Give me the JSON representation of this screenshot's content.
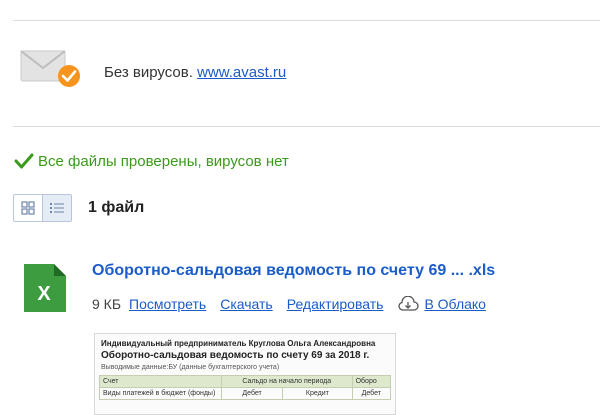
{
  "avast": {
    "text": "Без вирусов.",
    "link": "www.avast.ru"
  },
  "scan": {
    "status": "Все файлы проверены, вирусов нет"
  },
  "view": {
    "grid_icon": "grid-view-icon",
    "list_icon": "list-view-icon",
    "file_count": "1 файл"
  },
  "file": {
    "icon": "xls-icon",
    "badge": "X",
    "name": "Оборотно-сальдовая ведомость по счету 69 ... .xls",
    "size": "9 КБ",
    "actions": {
      "view": "Посмотреть",
      "download": "Скачать",
      "edit": "Редактировать",
      "cloud": "В Облако"
    }
  },
  "preview": {
    "line1": "Индивидуальный предприниматель Круглова Ольга Александровна",
    "line2": "Оборотно-сальдовая ведомость по счету 69 за 2018 г.",
    "line3": "Выводимые данные:БУ (данные бухгалтерского учета)",
    "row1": [
      "Счет",
      "Сальдо на начало периода",
      "Оборо"
    ],
    "row2": [
      "Виды платежей в бюджет (фонды)",
      "Дебет",
      "Кредит",
      "Дебет"
    ]
  },
  "colors": {
    "link": "#1a5cc8",
    "success": "#3a9a1a",
    "excel_green": "#3d9b40",
    "avast_orange": "#f7941d"
  }
}
